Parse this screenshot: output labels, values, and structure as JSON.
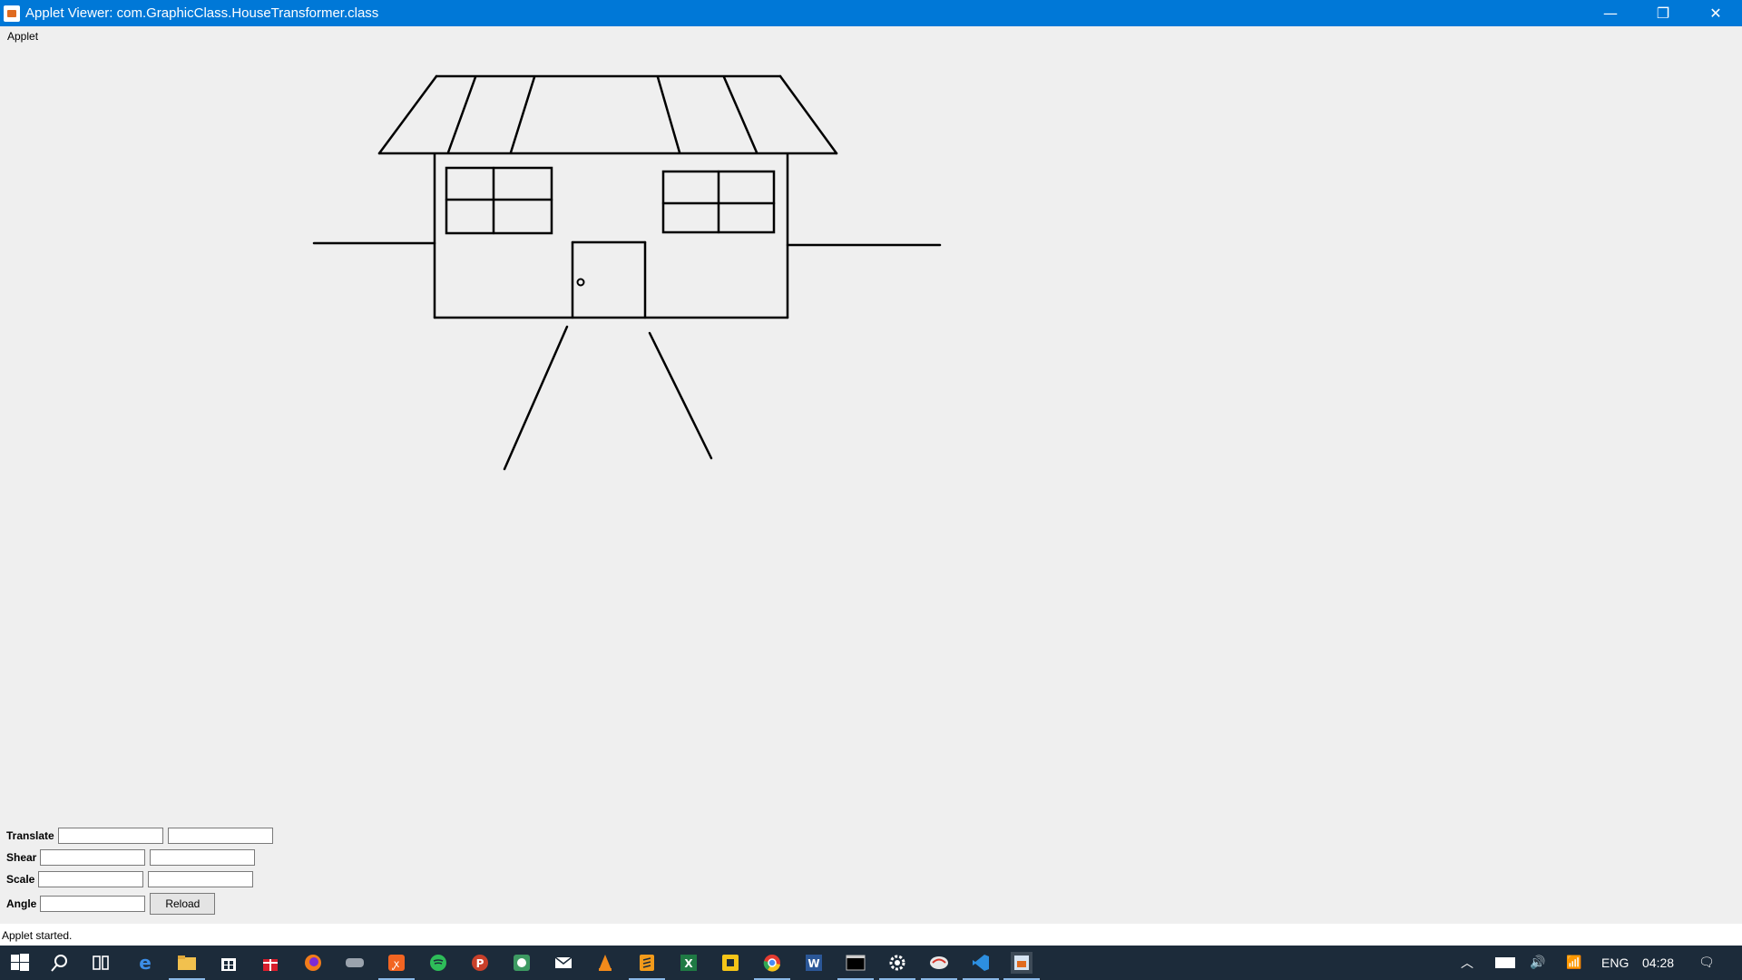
{
  "window": {
    "title": "Applet Viewer: com.GraphicClass.HouseTransformer.class",
    "minimize_glyph": "—",
    "restore_glyph": "❐",
    "close_glyph": "✕"
  },
  "menu": {
    "items": [
      "Applet"
    ]
  },
  "controls": {
    "translate_label": "Translate",
    "shear_label": "Shear",
    "scale_label": "Scale",
    "angle_label": "Angle",
    "translate_x": "",
    "translate_y": "",
    "shear_x": "",
    "shear_y": "",
    "scale_x": "",
    "scale_y": "",
    "angle": "",
    "reload_label": "Reload"
  },
  "status": {
    "text": "Applet started."
  },
  "taskbar": {
    "language": "ENG",
    "clock": "04:28",
    "apps": [
      "start-icon",
      "search-icon",
      "task-view-icon",
      "edge-icon",
      "file-explorer-icon",
      "store-icon",
      "gift-icon",
      "firefox-icon",
      "game-icon",
      "xampp-icon",
      "spotify-icon",
      "powerpoint-icon",
      "eclipse-icon",
      "mail-icon",
      "vlc-icon",
      "sublime-text-icon",
      "excel-icon",
      "app-yellow-icon",
      "chrome-icon",
      "word-icon",
      "terminal-icon",
      "settings-icon",
      "app-red-icon",
      "vscode-icon",
      "java-applet-icon"
    ]
  }
}
